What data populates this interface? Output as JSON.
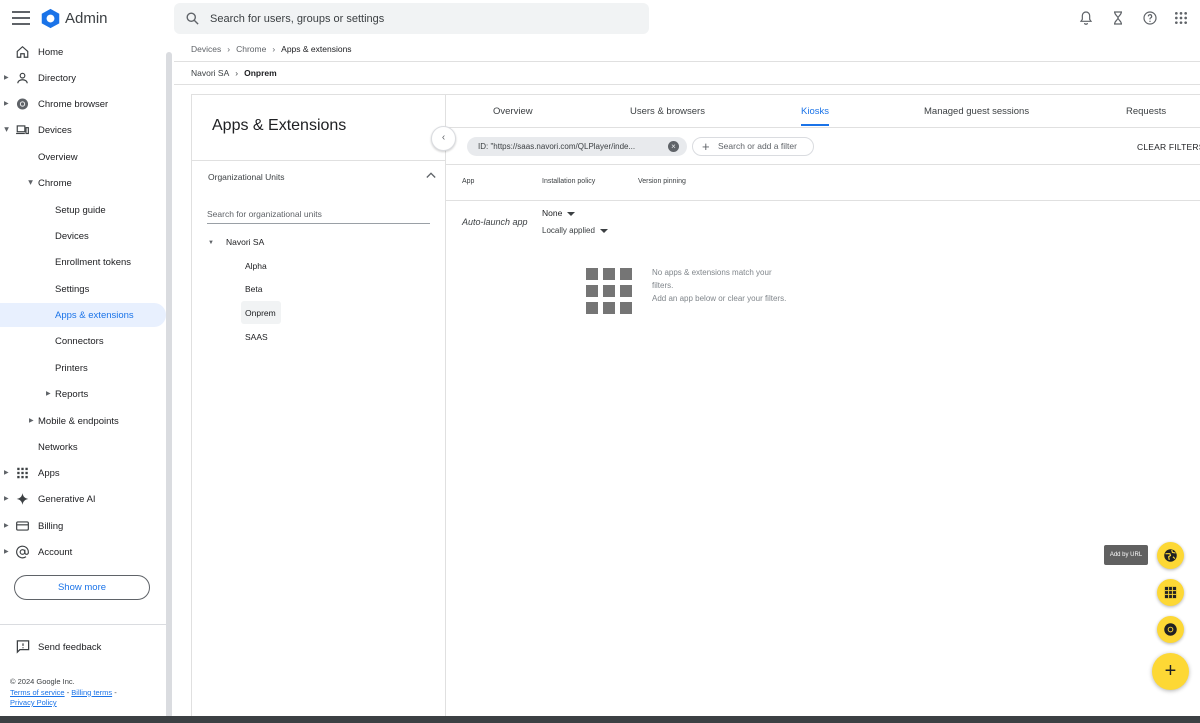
{
  "header": {
    "app_title": "Admin",
    "search_placeholder": "Search for users, groups or settings"
  },
  "sidebar": {
    "items": [
      {
        "label": "Home",
        "icon": "home-icon"
      },
      {
        "label": "Directory",
        "icon": "person-icon"
      },
      {
        "label": "Chrome browser",
        "icon": "chrome-icon"
      },
      {
        "label": "Devices",
        "icon": "devices-icon"
      },
      {
        "label": "Overview"
      },
      {
        "label": "Chrome"
      },
      {
        "label": "Setup guide"
      },
      {
        "label": "Devices"
      },
      {
        "label": "Enrollment tokens"
      },
      {
        "label": "Settings"
      },
      {
        "label": "Apps & extensions"
      },
      {
        "label": "Connectors"
      },
      {
        "label": "Printers"
      },
      {
        "label": "Reports"
      },
      {
        "label": "Mobile & endpoints"
      },
      {
        "label": "Networks"
      },
      {
        "label": "Apps",
        "icon": "apps-grid-icon"
      },
      {
        "label": "Generative AI",
        "icon": "sparkle-icon"
      },
      {
        "label": "Billing",
        "icon": "credit-card-icon"
      },
      {
        "label": "Account",
        "icon": "at-sign-icon"
      }
    ],
    "show_more": "Show more",
    "send_feedback": "Send feedback",
    "copyright": "© 2024 Google Inc.",
    "terms": "Terms of service",
    "billing_terms": "Billing terms",
    "privacy": "Privacy Policy"
  },
  "breadcrumb": {
    "items": [
      "Devices",
      "Chrome",
      "Apps & extensions"
    ],
    "ou_parent": "Navori SA",
    "ou_current": "Onprem"
  },
  "left_panel": {
    "title": "Apps & Extensions",
    "ou_header": "Organizational Units",
    "search_placeholder": "Search for organizational units",
    "tree_root": "Navori SA",
    "tree_children": [
      "Alpha",
      "Beta",
      "Onprem",
      "SAAS"
    ],
    "selected": "Onprem"
  },
  "tabs": [
    "Overview",
    "Users & browsers",
    "Kiosks",
    "Managed guest sessions",
    "Requests"
  ],
  "active_tab": "Kiosks",
  "filters": {
    "chip": "ID: \"https://saas.navori.com/QLPlayer/inde...",
    "add_filter": "Search or add a filter",
    "clear": "CLEAR FILTERS"
  },
  "table": {
    "columns": [
      "App",
      "Installation policy",
      "Version pinning"
    ],
    "row_label": "Auto-launch app",
    "policy_value": "None",
    "policy_sub": "Locally applied",
    "empty_line1": "No apps & extensions match your filters.",
    "empty_line2": "Add an app below or clear your filters."
  },
  "fab": {
    "tooltip": "Add by URL",
    "colors": {
      "fab": "#fdd835",
      "accent": "#1a73e8"
    }
  }
}
